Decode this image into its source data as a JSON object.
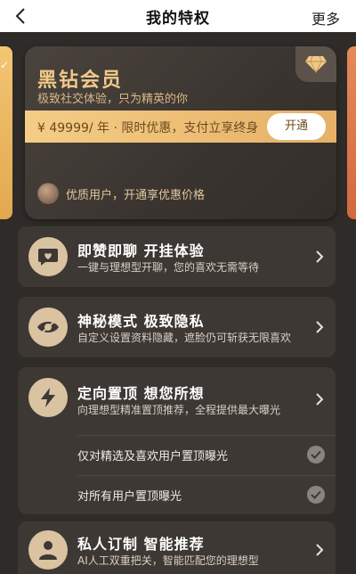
{
  "nav": {
    "title": "我的特权",
    "more": "更多"
  },
  "card": {
    "title": "黑钻会员",
    "subtitle": "极致社交体验，只为精英的你",
    "price_text": "¥ 49999/ 年 · 限时优惠，支付立享终身",
    "open_label": "开通",
    "footer_text": "优质用户，开通享优惠价格"
  },
  "features": [
    {
      "title": "即赞即聊 开挂体验",
      "desc": "一键与理想型开聊，您的喜欢无需等待",
      "icon": "heart-chat-icon"
    },
    {
      "title": "神秘模式 极致隐私",
      "desc": "自定义设置资料隐藏，遮脸仍可斩获无限喜欢",
      "icon": "hidden-eye-icon"
    },
    {
      "title": "定向置顶 想您所想",
      "desc": "向理想型精准置顶推荐，全程提供最大曝光",
      "icon": "lightning-icon",
      "options": [
        "仅对精选及喜欢用户置顶曝光",
        "对所有用户置顶曝光"
      ]
    },
    {
      "title": "私人订制 智能推荐",
      "desc": "AI人工双重把关，智能匹配您的理想型",
      "icon": "person-icon"
    }
  ],
  "colors": {
    "gold": "#f0c98a",
    "strip": "#f4cd86",
    "bg": "#2f2b28",
    "panel": "#3d3834"
  }
}
